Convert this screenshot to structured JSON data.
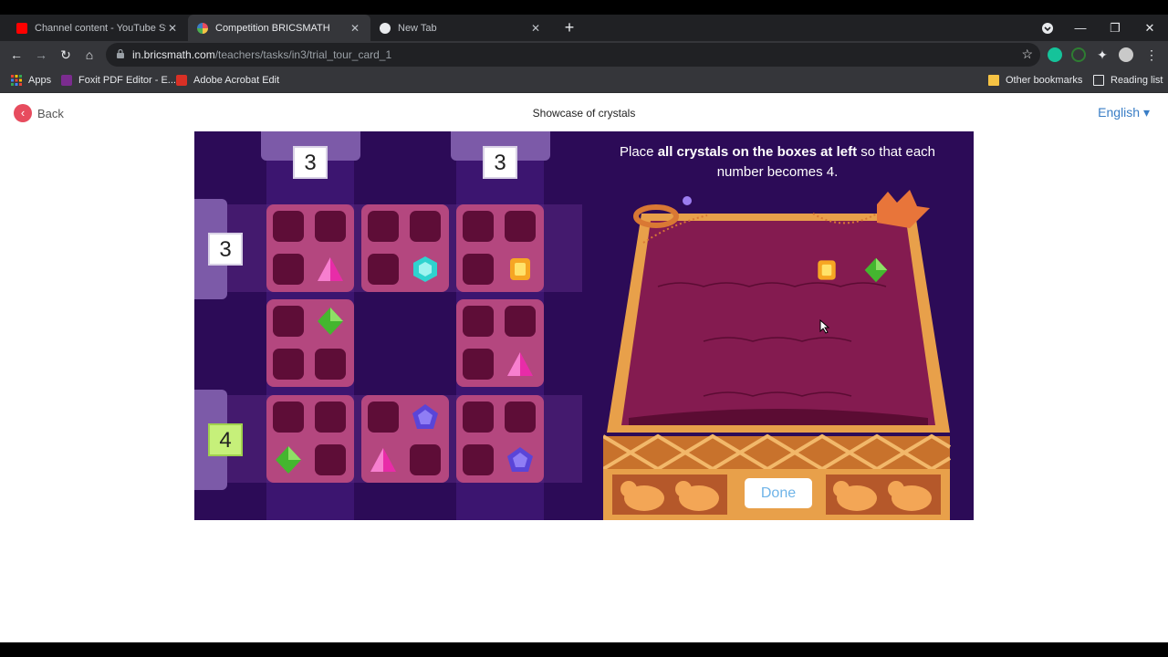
{
  "browser": {
    "tabs": [
      {
        "title": "Channel content - YouTube Studi",
        "active": false
      },
      {
        "title": "Competition BRICSMATH",
        "active": true
      },
      {
        "title": "New Tab",
        "active": false
      }
    ],
    "url_host": "in.bricsmath.com",
    "url_path": "/teachers/tasks/in3/trial_tour_card_1",
    "bookmarks": {
      "apps": "Apps",
      "foxit": "Foxit PDF Editor - E...",
      "acrobat": "Adobe Acrobat Edit",
      "other": "Other bookmarks",
      "reading": "Reading list"
    }
  },
  "page": {
    "back_label": "Back",
    "title": "Showcase of crystals",
    "language": "English"
  },
  "game": {
    "prompt_pre": "Place ",
    "prompt_bold": "all crystals on the boxes at left",
    "prompt_post": " so that each number becomes 4.",
    "column_numbers": [
      "3",
      "3"
    ],
    "row_numbers": [
      "3",
      "4"
    ],
    "done_label": "Done"
  },
  "colors": {
    "game_bg": "#2c0b57",
    "block": "#b4477f",
    "slot": "#5e0d37",
    "satisfied_number": "#c6f07a",
    "chest_frame": "#e8a04a",
    "chest_cloth": "#841b50"
  }
}
